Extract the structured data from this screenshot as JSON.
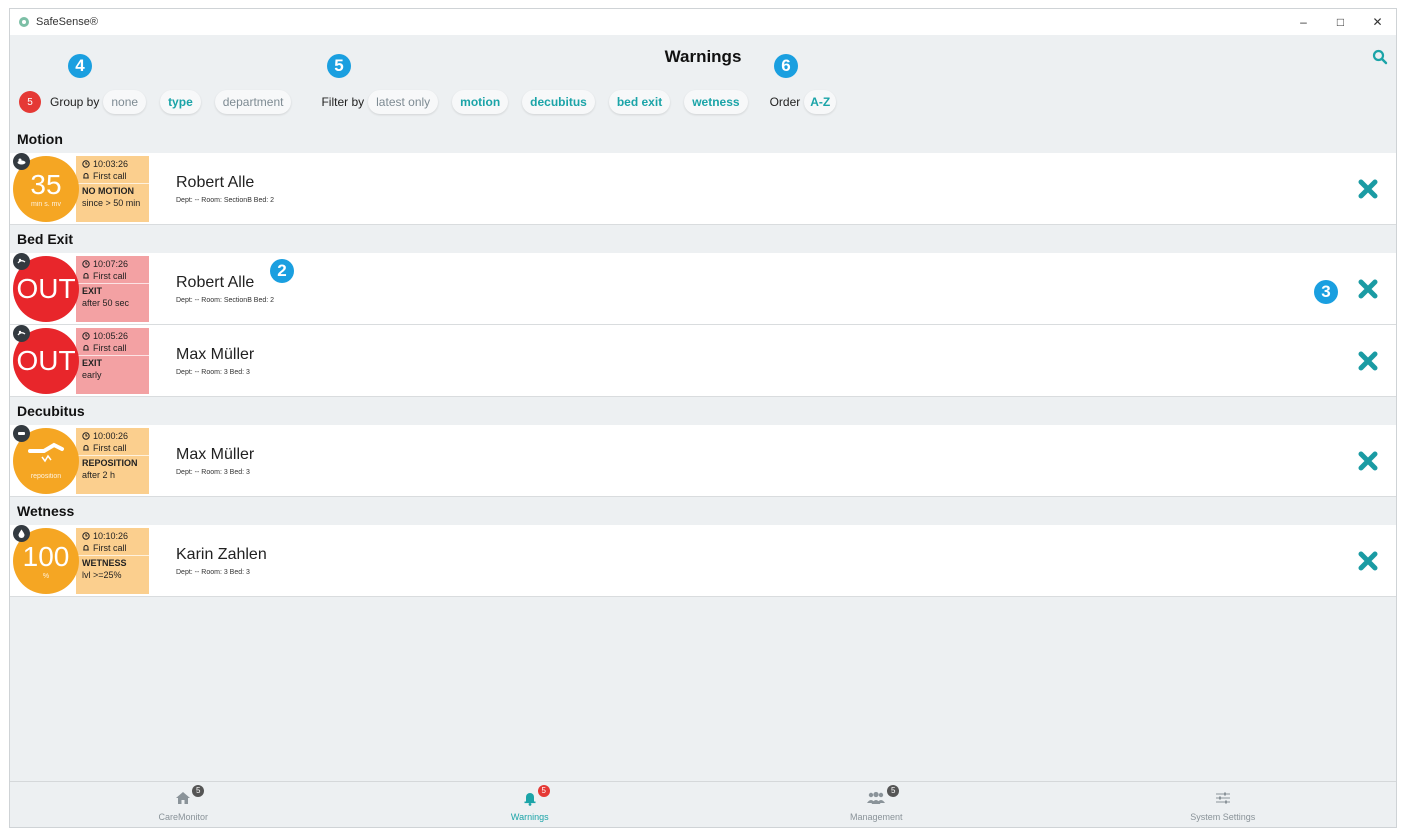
{
  "window": {
    "title": "SafeSense®"
  },
  "header": {
    "title": "Warnings"
  },
  "toolbar": {
    "count": "5",
    "group_by_label": "Group by",
    "group_options": [
      {
        "label": "none",
        "active": false
      },
      {
        "label": "type",
        "active": true
      },
      {
        "label": "department",
        "active": false
      }
    ],
    "filter_by_label": "Filter by",
    "filter_options": [
      {
        "label": "latest only",
        "active": false
      },
      {
        "label": "motion",
        "active": true
      },
      {
        "label": "decubitus",
        "active": true
      },
      {
        "label": "bed exit",
        "active": true
      },
      {
        "label": "wetness",
        "active": true
      }
    ],
    "order_label": "Order",
    "order_value": "A-Z"
  },
  "markers": [
    "4",
    "5",
    "6",
    "2",
    "3"
  ],
  "groups": [
    {
      "title": "Motion",
      "warnings": [
        {
          "color": "orange",
          "icon": "sleeping-person-icon",
          "value": "35",
          "unit": "min s. mv",
          "time": "10:03:26",
          "call": "First call",
          "status": "NO MOTION",
          "detail": "since > 50 min",
          "name": "Robert Alle",
          "meta": "Dept: --  Room: SectionB  Bed: 2"
        }
      ]
    },
    {
      "title": "Bed Exit",
      "warnings": [
        {
          "color": "red",
          "icon": "bed-exit-icon",
          "value": "OUT",
          "unit": "",
          "time": "10:07:26",
          "call": "First call",
          "status": "EXIT",
          "detail": "after 50 sec",
          "name": "Robert Alle",
          "meta": "Dept: --  Room: SectionB  Bed: 2"
        },
        {
          "color": "red",
          "icon": "bed-exit-icon",
          "value": "OUT",
          "unit": "",
          "time": "10:05:26",
          "call": "First call",
          "status": "EXIT",
          "detail": "early",
          "name": "Max Müller",
          "meta": "Dept: --  Room: 3  Bed: 3"
        }
      ]
    },
    {
      "title": "Decubitus",
      "warnings": [
        {
          "color": "orange",
          "icon": "decubitus-icon",
          "value": "",
          "unit": "reposition",
          "time": "10:00:26",
          "call": "First call",
          "status": "REPOSITION",
          "detail": "after 2 h",
          "name": "Max Müller",
          "meta": "Dept: --  Room: 3  Bed: 3"
        }
      ]
    },
    {
      "title": "Wetness",
      "warnings": [
        {
          "color": "orange",
          "icon": "droplet-icon",
          "value": "100",
          "unit": "%",
          "time": "10:10:26",
          "call": "First call",
          "status": "WETNESS",
          "detail": "lvl >=25%",
          "name": "Karin Zahlen",
          "meta": "Dept: --  Room: 3  Bed: 3"
        }
      ]
    }
  ],
  "nav": [
    {
      "label": "CareMonitor",
      "icon": "home-icon",
      "badge": "5",
      "active": false
    },
    {
      "label": "Warnings",
      "icon": "bell-icon",
      "badge": "5",
      "active": true
    },
    {
      "label": "Management",
      "icon": "people-icon",
      "badge": "5",
      "active": false
    },
    {
      "label": "System Settings",
      "icon": "sliders-icon",
      "badge": "",
      "active": false
    }
  ],
  "colors": {
    "accent": "#1ba4a8",
    "alert_red": "#e8262b",
    "warning_orange": "#f5a623",
    "marker_blue": "#1a9fe0"
  }
}
